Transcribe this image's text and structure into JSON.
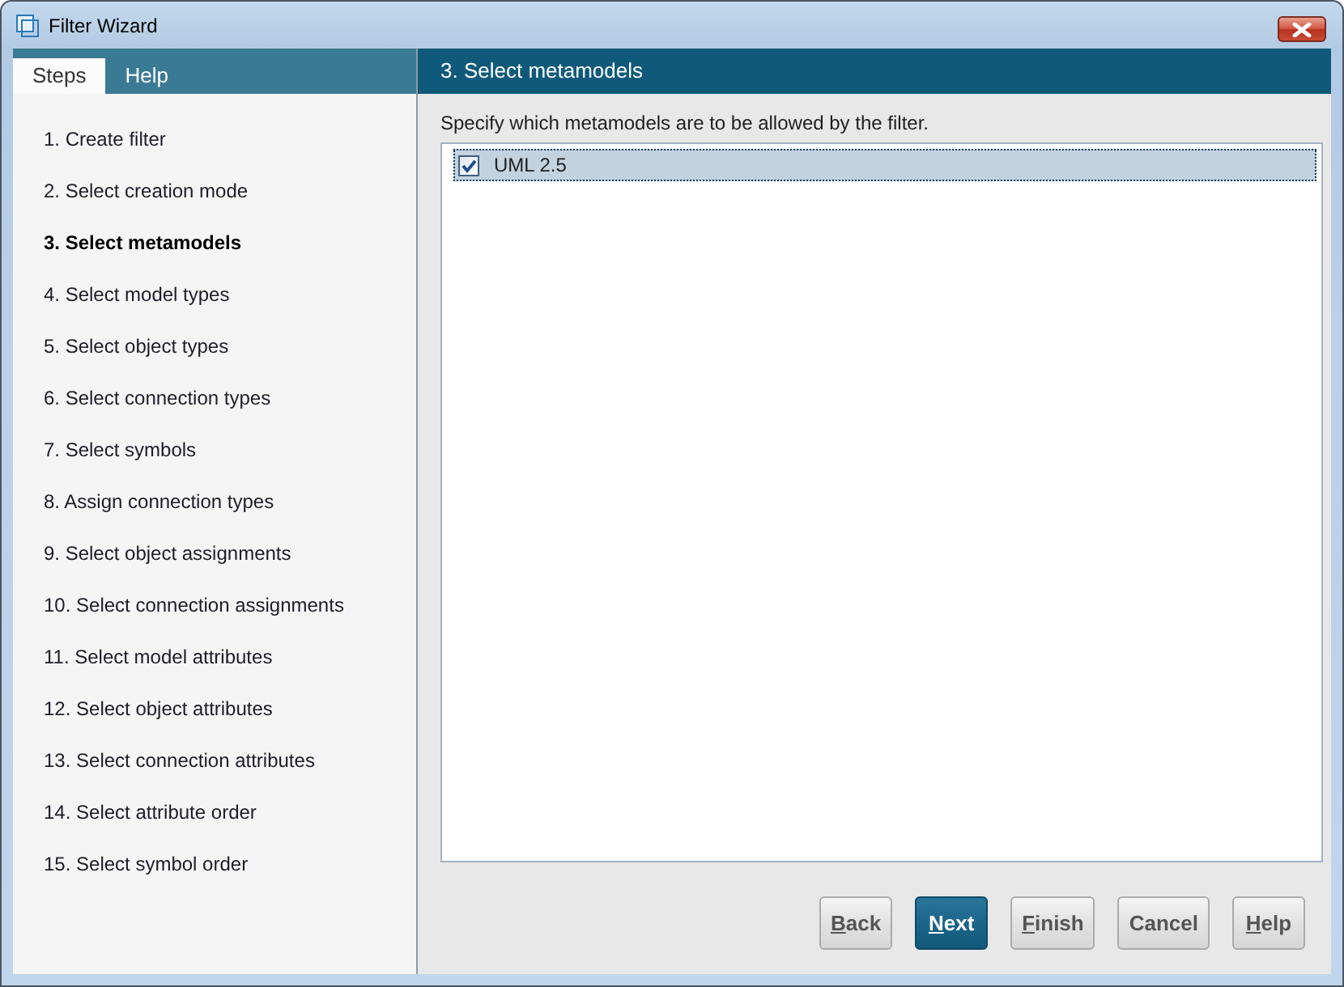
{
  "window": {
    "title": "Filter Wizard"
  },
  "sidebar": {
    "tabs": [
      {
        "label": "Steps",
        "selected": true
      },
      {
        "label": "Help",
        "selected": false
      }
    ],
    "steps": [
      {
        "label": "1. Create filter",
        "selected": false
      },
      {
        "label": "2. Select creation mode",
        "selected": false
      },
      {
        "label": "3. Select metamodels",
        "selected": true
      },
      {
        "label": "4. Select model types",
        "selected": false
      },
      {
        "label": "5. Select object types",
        "selected": false
      },
      {
        "label": "6. Select connection types",
        "selected": false
      },
      {
        "label": "7. Select symbols",
        "selected": false
      },
      {
        "label": "8. Assign connection types",
        "selected": false
      },
      {
        "label": "9. Select object assignments",
        "selected": false
      },
      {
        "label": "10. Select connection assignments",
        "selected": false
      },
      {
        "label": "11. Select model attributes",
        "selected": false
      },
      {
        "label": "12. Select object attributes",
        "selected": false
      },
      {
        "label": "13. Select connection attributes",
        "selected": false
      },
      {
        "label": "14. Select attribute order",
        "selected": false
      },
      {
        "label": "15. Select symbol order",
        "selected": false
      }
    ]
  },
  "page": {
    "title": "3. Select metamodels",
    "prompt": "Specify which metamodels are to be allowed by the filter.",
    "metamodels": [
      {
        "label": "UML 2.5",
        "checked": true,
        "selected": true
      }
    ]
  },
  "buttons": [
    {
      "label": "Back",
      "mnemonic": true,
      "default": false
    },
    {
      "label": "Next",
      "mnemonic": true,
      "default": true
    },
    {
      "label": "Finish",
      "mnemonic": true,
      "default": false
    },
    {
      "label": "Cancel",
      "mnemonic": false,
      "default": false
    },
    {
      "label": "Help",
      "mnemonic": true,
      "default": false
    }
  ]
}
